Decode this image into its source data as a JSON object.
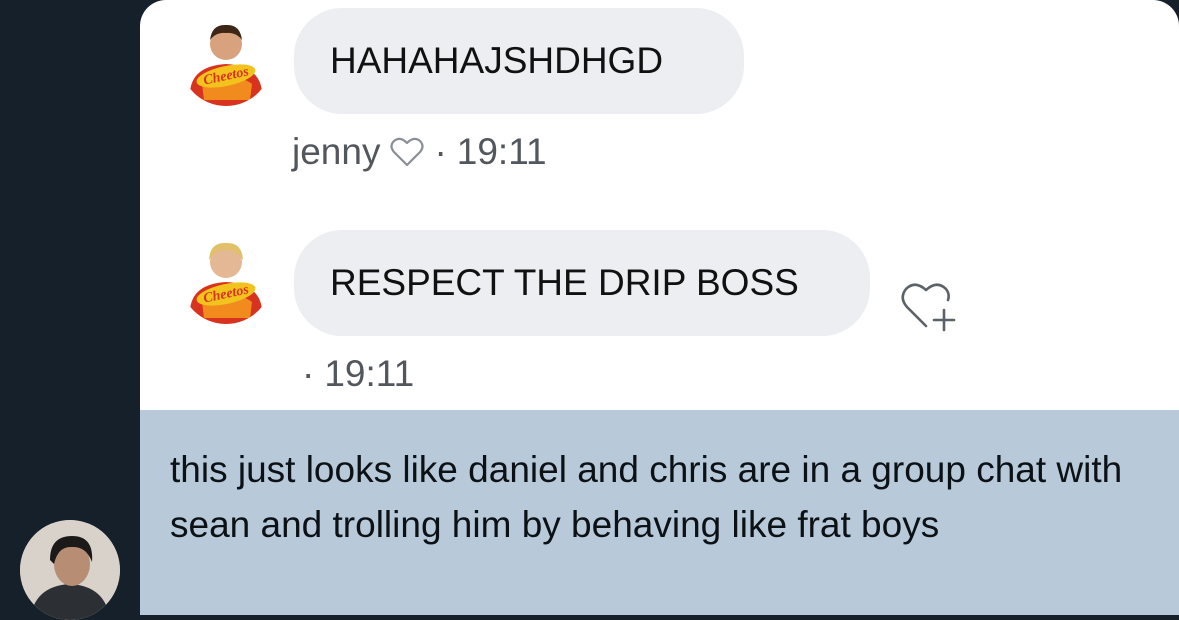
{
  "messages": [
    {
      "text": "HAHAHAJSHDHGD",
      "author": "jenny",
      "time": "19:11",
      "separator": "·",
      "avatar_label": "Cheetos"
    },
    {
      "text": "RESPECT THE DRIP BOSS",
      "author": "",
      "time": "19:11",
      "separator": "·",
      "avatar_label": "Cheetos"
    }
  ],
  "reply": {
    "text": "this just looks like daniel and chris are in a group chat with sean and trolling him by behaving like frat boys"
  },
  "icons": {
    "heart": "heart-outline-icon",
    "add_reaction": "add-reaction-icon"
  },
  "colors": {
    "background": "#15202b",
    "bubble": "#eceef2",
    "reply_bg": "#b8cad9",
    "meta_text": "#52575d"
  }
}
